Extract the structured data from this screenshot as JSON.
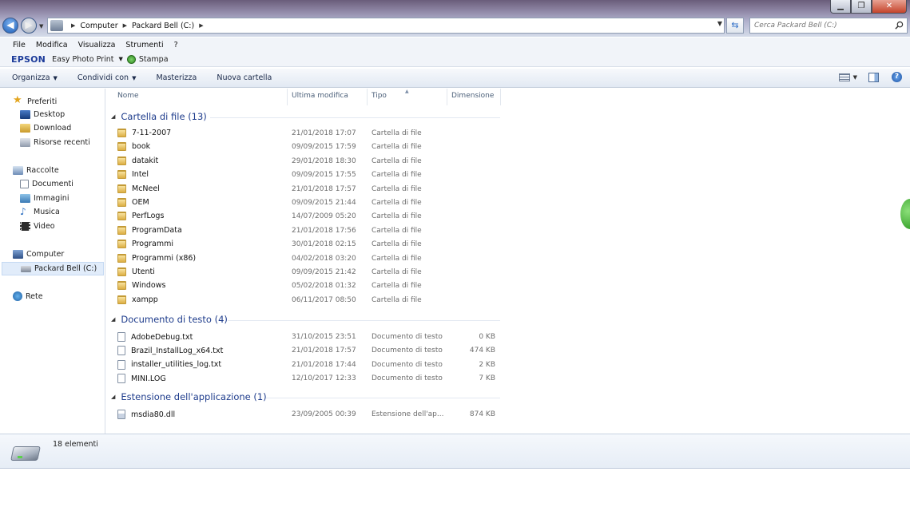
{
  "window": {
    "minimize": "▁",
    "maximize": "❐",
    "close": "✕"
  },
  "address": {
    "crumbs": [
      "Computer",
      "Packard Bell (C:)"
    ],
    "search_placeholder": "Cerca Packard Bell (C:)"
  },
  "menu": [
    "File",
    "Modifica",
    "Visualizza",
    "Strumenti",
    "?"
  ],
  "epson": {
    "logo": "EPSON",
    "app": "Easy Photo Print",
    "print": "Stampa"
  },
  "commands": {
    "organize": "Organizza",
    "share": "Condividi con",
    "burn": "Masterizza",
    "new_folder": "Nuova cartella"
  },
  "nav": {
    "favorites": "Preferiti",
    "fav_items": [
      "Desktop",
      "Download",
      "Risorse recenti"
    ],
    "libraries": "Raccolte",
    "lib_items": [
      "Documenti",
      "Immagini",
      "Musica",
      "Video"
    ],
    "computer": "Computer",
    "drive": "Packard Bell (C:)",
    "network": "Rete"
  },
  "columns": {
    "name": "Nome",
    "modified": "Ultima modifica",
    "type": "Tipo",
    "size": "Dimensione"
  },
  "groups": [
    {
      "title": "Cartella di file (13)",
      "kind": "folder",
      "items": [
        {
          "name": "7-11-2007",
          "date": "21/01/2018 17:07",
          "type": "Cartella di file",
          "size": ""
        },
        {
          "name": "book",
          "date": "09/09/2015 17:59",
          "type": "Cartella di file",
          "size": ""
        },
        {
          "name": "datakit",
          "date": "29/01/2018 18:30",
          "type": "Cartella di file",
          "size": ""
        },
        {
          "name": "Intel",
          "date": "09/09/2015 17:55",
          "type": "Cartella di file",
          "size": ""
        },
        {
          "name": "McNeel",
          "date": "21/01/2018 17:57",
          "type": "Cartella di file",
          "size": ""
        },
        {
          "name": "OEM",
          "date": "09/09/2015 21:44",
          "type": "Cartella di file",
          "size": ""
        },
        {
          "name": "PerfLogs",
          "date": "14/07/2009 05:20",
          "type": "Cartella di file",
          "size": ""
        },
        {
          "name": "ProgramData",
          "date": "21/01/2018 17:56",
          "type": "Cartella di file",
          "size": ""
        },
        {
          "name": "Programmi",
          "date": "30/01/2018 02:15",
          "type": "Cartella di file",
          "size": ""
        },
        {
          "name": "Programmi (x86)",
          "date": "04/02/2018 03:20",
          "type": "Cartella di file",
          "size": ""
        },
        {
          "name": "Utenti",
          "date": "09/09/2015 21:42",
          "type": "Cartella di file",
          "size": ""
        },
        {
          "name": "Windows",
          "date": "05/02/2018 01:32",
          "type": "Cartella di file",
          "size": ""
        },
        {
          "name": "xampp",
          "date": "06/11/2017 08:50",
          "type": "Cartella di file",
          "size": ""
        }
      ]
    },
    {
      "title": "Documento di testo (4)",
      "kind": "txt",
      "items": [
        {
          "name": "AdobeDebug.txt",
          "date": "31/10/2015 23:51",
          "type": "Documento di testo",
          "size": "0 KB"
        },
        {
          "name": "Brazil_InstallLog_x64.txt",
          "date": "21/01/2018 17:57",
          "type": "Documento di testo",
          "size": "474 KB"
        },
        {
          "name": "installer_utilities_log.txt",
          "date": "21/01/2018 17:44",
          "type": "Documento di testo",
          "size": "2 KB"
        },
        {
          "name": "MINI.LOG",
          "date": "12/10/2017 12:33",
          "type": "Documento di testo",
          "size": "7 KB"
        }
      ]
    },
    {
      "title": "Estensione dell'applicazione (1)",
      "kind": "dll",
      "items": [
        {
          "name": "msdia80.dll",
          "date": "23/09/2005 00:39",
          "type": "Estensione dell'ap...",
          "size": "874 KB"
        }
      ]
    }
  ],
  "details": {
    "count": "18 elementi"
  }
}
